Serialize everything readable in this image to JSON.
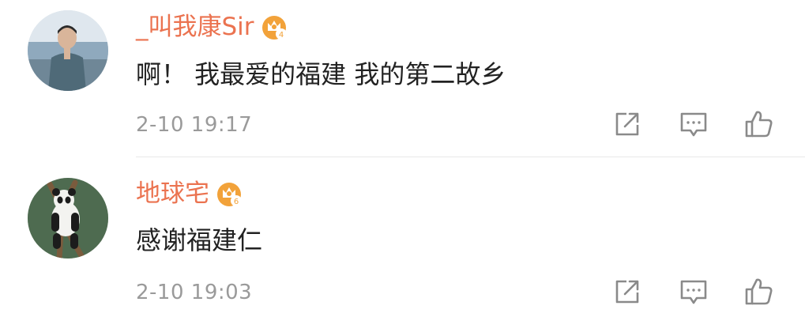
{
  "comments": [
    {
      "username": "_叫我康Sir",
      "crown_level": "4",
      "text": "啊！ 我最爱的福建 我的第二故乡",
      "timestamp": "2-10 19:17"
    },
    {
      "username": "地球宅",
      "crown_level": "6",
      "text": "感谢福建仁",
      "timestamp": "2-10 19:03"
    }
  ],
  "icons": {
    "share": "share-icon",
    "comment": "comment-icon",
    "like": "like-icon",
    "crown": "crown-badge-icon"
  },
  "colors": {
    "username": "#eb7350",
    "crown": "#f2a23a",
    "text": "#222222",
    "meta": "#9a9a9a",
    "icon": "#8a8a8a"
  }
}
